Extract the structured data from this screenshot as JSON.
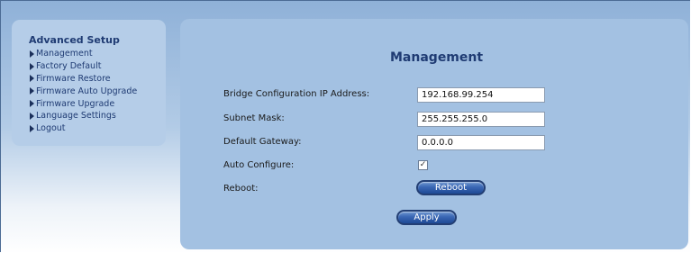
{
  "sidebar": {
    "title": "Advanced Setup",
    "items": [
      {
        "label": "Management"
      },
      {
        "label": "Factory Default"
      },
      {
        "label": "Firmware Restore"
      },
      {
        "label": "Firmware Auto Upgrade"
      },
      {
        "label": "Firmware Upgrade"
      },
      {
        "label": "Language Settings"
      },
      {
        "label": "Logout"
      }
    ]
  },
  "main": {
    "title": "Management",
    "fields": {
      "bridge_ip": {
        "label": "Bridge Configuration IP Address:",
        "value": "192.168.99.254"
      },
      "subnet": {
        "label": "Subnet Mask:",
        "value": "255.255.255.0"
      },
      "gateway": {
        "label": "Default Gateway:",
        "value": "0.0.0.0"
      }
    },
    "auto_configure": {
      "label": "Auto Configure:",
      "checked": true,
      "mark": "✓"
    },
    "reboot": {
      "label": "Reboot:",
      "button": "Reboot"
    },
    "apply_button": "Apply"
  }
}
